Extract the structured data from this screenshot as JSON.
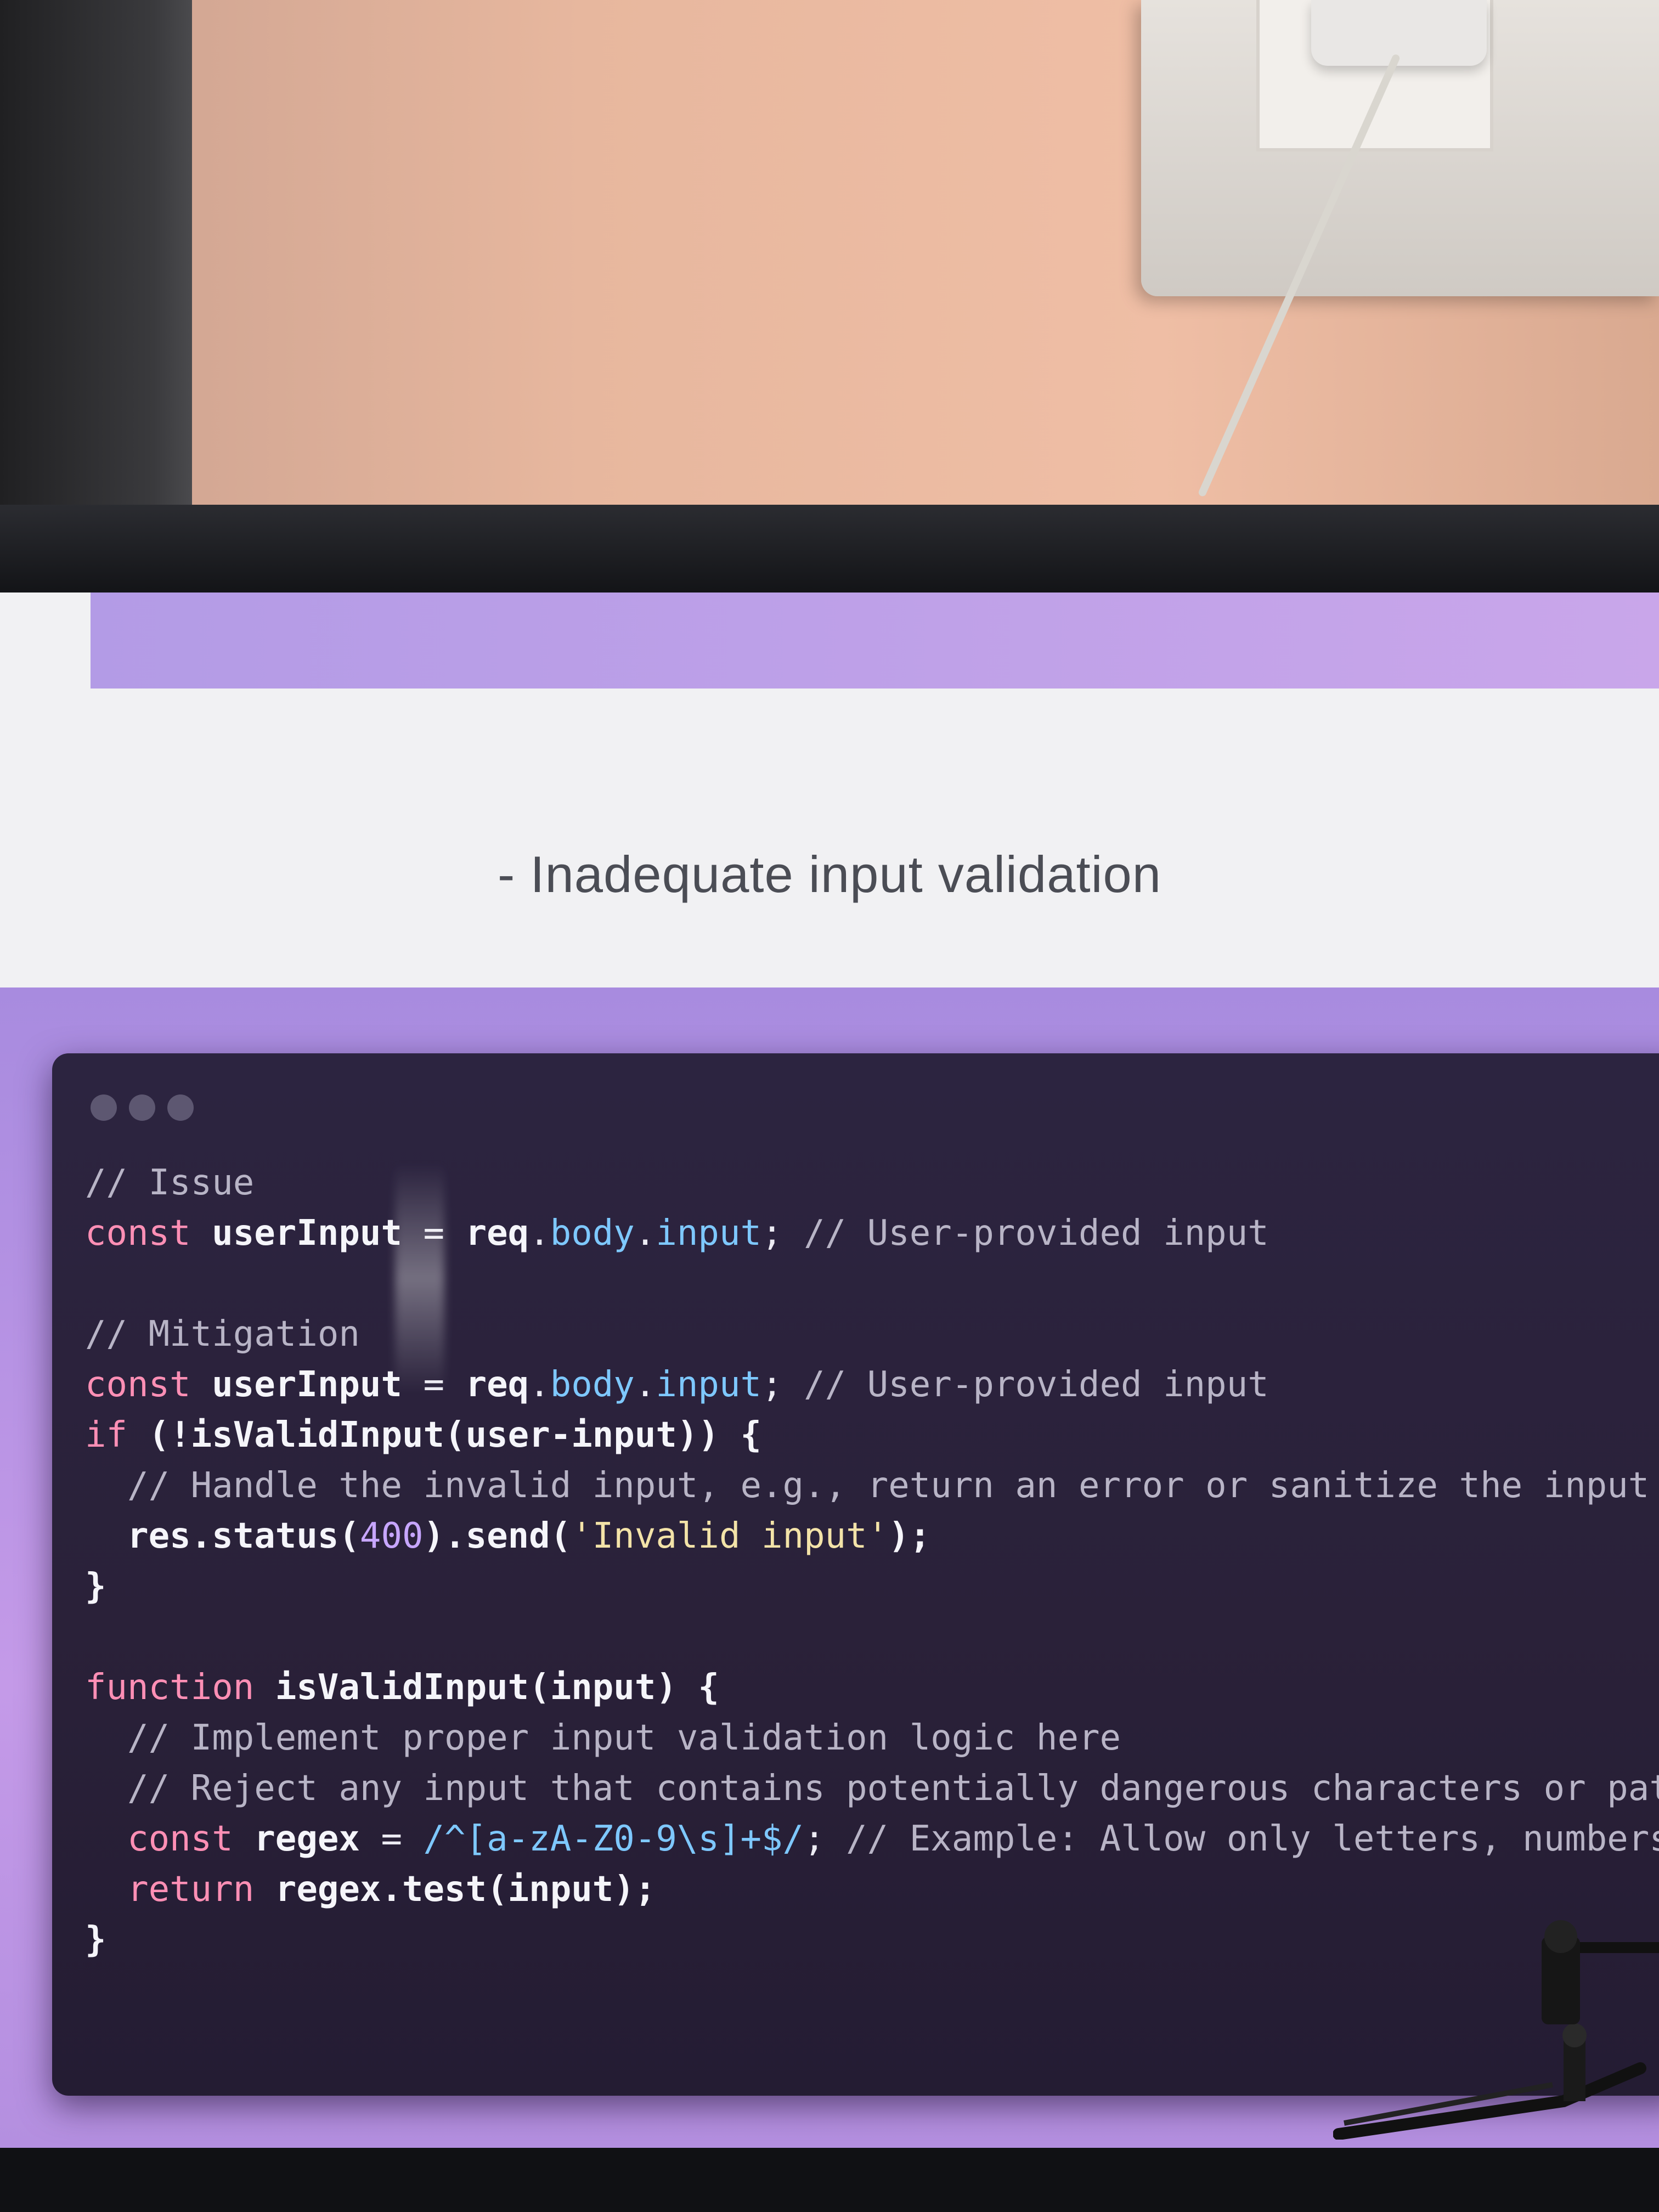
{
  "slide": {
    "text": "- Inadequate input validation"
  },
  "code_window": {
    "lines": [
      [
        {
          "t": "// Issue",
          "c": "c"
        }
      ],
      [
        {
          "t": "const ",
          "c": "k"
        },
        {
          "t": "userInput",
          "c": "w"
        },
        {
          "t": " = ",
          "c": ""
        },
        {
          "t": "req",
          "c": "w"
        },
        {
          "t": ".",
          "c": ""
        },
        {
          "t": "body",
          "c": "p"
        },
        {
          "t": ".",
          "c": ""
        },
        {
          "t": "input",
          "c": "p"
        },
        {
          "t": "; ",
          "c": ""
        },
        {
          "t": "// User-provided input",
          "c": "c"
        }
      ],
      [],
      [
        {
          "t": "// Mitigation",
          "c": "c"
        }
      ],
      [
        {
          "t": "const ",
          "c": "k"
        },
        {
          "t": "userInput",
          "c": "w"
        },
        {
          "t": " = ",
          "c": ""
        },
        {
          "t": "req",
          "c": "w"
        },
        {
          "t": ".",
          "c": ""
        },
        {
          "t": "body",
          "c": "p"
        },
        {
          "t": ".",
          "c": ""
        },
        {
          "t": "input",
          "c": "p"
        },
        {
          "t": "; ",
          "c": ""
        },
        {
          "t": "// User-provided input",
          "c": "c"
        }
      ],
      [
        {
          "t": "if ",
          "c": "k"
        },
        {
          "t": "(!isValidInput(user-input)) {",
          "c": "w"
        }
      ],
      [
        {
          "t": "  // Handle the invalid input, e.g., return an error or sanitize the input",
          "c": "c"
        }
      ],
      [
        {
          "t": "  res.status(",
          "c": "w"
        },
        {
          "t": "400",
          "c": "n"
        },
        {
          "t": ").send(",
          "c": "w"
        },
        {
          "t": "'Invalid input'",
          "c": "s"
        },
        {
          "t": ");",
          "c": "w"
        }
      ],
      [
        {
          "t": "}",
          "c": "w"
        }
      ],
      [],
      [
        {
          "t": "function ",
          "c": "k"
        },
        {
          "t": "isValidInput(input) {",
          "c": "w"
        }
      ],
      [
        {
          "t": "  // Implement proper input validation logic here",
          "c": "c"
        }
      ],
      [
        {
          "t": "  // Reject any input that contains potentially dangerous characters or patt",
          "c": "c"
        }
      ],
      [
        {
          "t": "  const ",
          "c": "k"
        },
        {
          "t": "regex",
          "c": "w"
        },
        {
          "t": " = ",
          "c": ""
        },
        {
          "t": "/^[a-zA-Z0-9\\s]+$/",
          "c": "p"
        },
        {
          "t": "; ",
          "c": ""
        },
        {
          "t": "// Example: Allow only letters, numbers,",
          "c": "c"
        }
      ],
      [
        {
          "t": "  return ",
          "c": "k"
        },
        {
          "t": "regex.test(input);",
          "c": "w"
        }
      ],
      [
        {
          "t": "}",
          "c": "w"
        }
      ]
    ]
  }
}
